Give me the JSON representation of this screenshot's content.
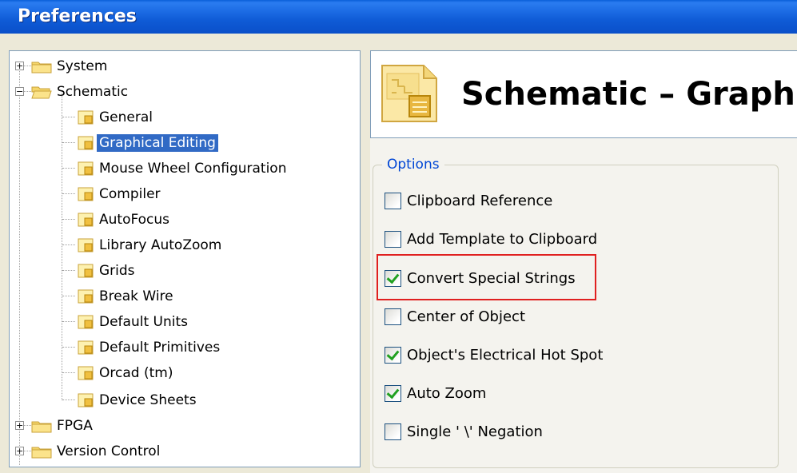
{
  "window": {
    "title": "Preferences"
  },
  "tree": {
    "items": [
      {
        "label": "System",
        "expander": "+"
      },
      {
        "label": "Schematic",
        "expander": "−"
      },
      {
        "label": "General"
      },
      {
        "label": "Graphical Editing",
        "selected": true
      },
      {
        "label": "Mouse Wheel Configuration"
      },
      {
        "label": "Compiler"
      },
      {
        "label": "AutoFocus"
      },
      {
        "label": "Library AutoZoom"
      },
      {
        "label": "Grids"
      },
      {
        "label": "Break Wire"
      },
      {
        "label": "Default Units"
      },
      {
        "label": "Default Primitives"
      },
      {
        "label": "Orcad (tm)"
      },
      {
        "label": "Device Sheets"
      },
      {
        "label": "FPGA",
        "expander": "+"
      },
      {
        "label": "Version Control",
        "expander": "+"
      }
    ]
  },
  "page": {
    "title": "Schematic – Graph"
  },
  "options": {
    "legend": "Options",
    "items": [
      {
        "label": "Clipboard Reference",
        "checked": false
      },
      {
        "label": "Add Template to Clipboard",
        "checked": false
      },
      {
        "label": "Convert Special Strings",
        "checked": true
      },
      {
        "label": "Center of Object",
        "checked": false
      },
      {
        "label": "Object's Electrical Hot Spot",
        "checked": true
      },
      {
        "label": "Auto Zoom",
        "checked": true
      },
      {
        "label": "Single ' \\' Negation",
        "checked": false
      }
    ]
  },
  "colors": {
    "title_bar": "#0a5fd9",
    "selection": "#316ac5",
    "group_legend": "#0046d5",
    "check_mark": "#21a121",
    "highlight": "#e02020"
  }
}
